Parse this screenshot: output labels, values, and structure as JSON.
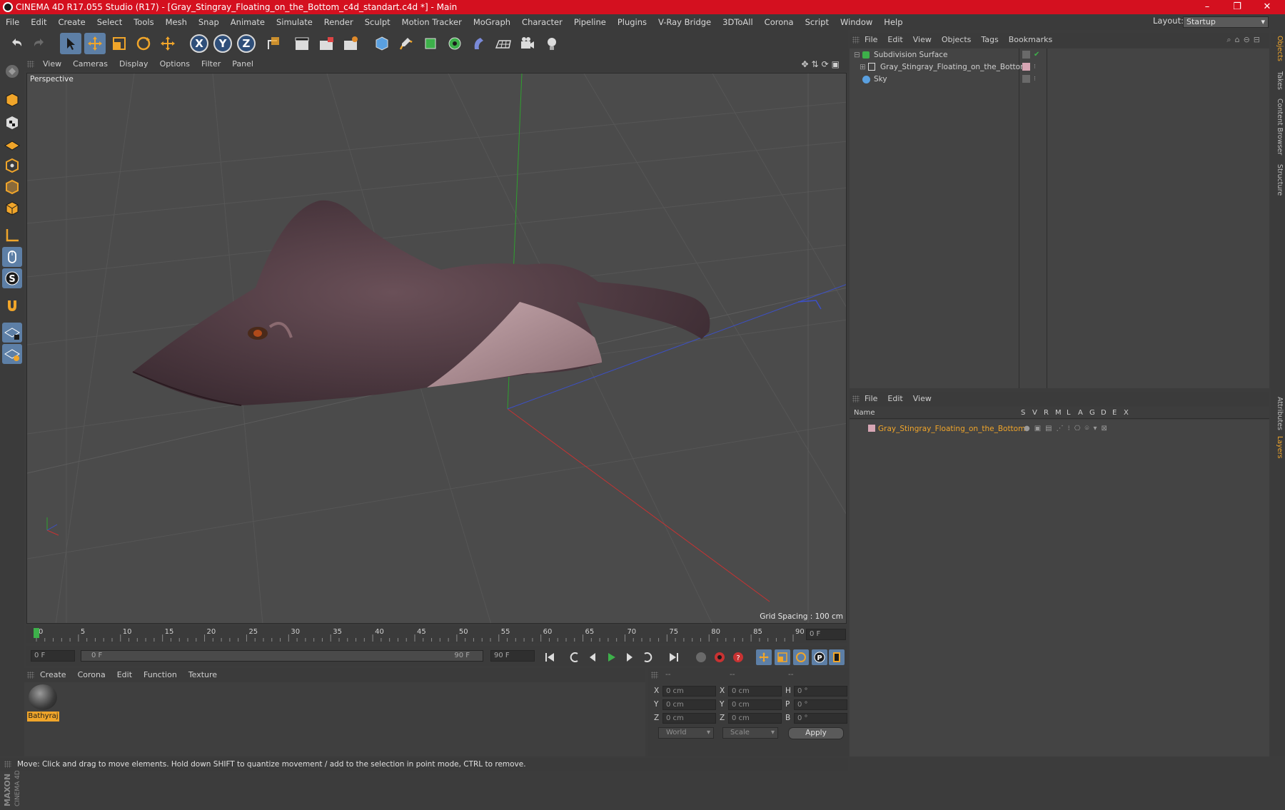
{
  "window": {
    "title": "CINEMA 4D R17.055 Studio (R17) - [Gray_Stingray_Floating_on_the_Bottom_c4d_standart.c4d *] - Main",
    "minimize": "–",
    "restore": "❐",
    "close": "✕"
  },
  "menu": [
    "File",
    "Edit",
    "Create",
    "Select",
    "Tools",
    "Mesh",
    "Snap",
    "Animate",
    "Simulate",
    "Render",
    "Sculpt",
    "Motion Tracker",
    "MoGraph",
    "Character",
    "Pipeline",
    "Plugins",
    "V-Ray Bridge",
    "3DToAll",
    "Corona",
    "Script",
    "Window",
    "Help"
  ],
  "layout": {
    "label": "Layout:",
    "value": "Startup"
  },
  "toolbar": {
    "axis_x": "X",
    "axis_y": "Y",
    "axis_z": "Z"
  },
  "viewport": {
    "menu": [
      "View",
      "Cameras",
      "Display",
      "Options",
      "Filter",
      "Panel"
    ],
    "label": "Perspective",
    "grid_spacing": "Grid Spacing : 100 cm"
  },
  "timeline": {
    "ticks": [
      "0",
      "5",
      "10",
      "15",
      "20",
      "25",
      "30",
      "35",
      "40",
      "45",
      "50",
      "55",
      "60",
      "65",
      "70",
      "75",
      "80",
      "85",
      "90"
    ],
    "current_frame": "0 F",
    "start_field": "0 F",
    "range_start": "0 F",
    "range_end": "90 F",
    "end_field": "90 F"
  },
  "material_manager": {
    "menu": [
      "Create",
      "Corona",
      "Edit",
      "Function",
      "Texture"
    ],
    "materials": [
      {
        "name": "Bathyraj"
      }
    ]
  },
  "coordinates": {
    "headers": [
      "--",
      "--",
      "--"
    ],
    "rows": [
      {
        "a": "X",
        "av": "0 cm",
        "b": "X",
        "bv": "0 cm",
        "c": "H",
        "cv": "0 °"
      },
      {
        "a": "Y",
        "av": "0 cm",
        "b": "Y",
        "bv": "0 cm",
        "c": "P",
        "cv": "0 °"
      },
      {
        "a": "Z",
        "av": "0 cm",
        "b": "Z",
        "bv": "0 cm",
        "c": "B",
        "cv": "0 °"
      }
    ],
    "space": "World",
    "mode": "Scale",
    "apply": "Apply"
  },
  "status": "Move: Click and drag to move elements. Hold down SHIFT to quantize movement / add to the selection in point mode, CTRL to remove.",
  "object_manager": {
    "menu": [
      "File",
      "Edit",
      "View",
      "Objects",
      "Tags",
      "Bookmarks"
    ],
    "objects": [
      {
        "name": "Subdivision Surface"
      },
      {
        "name": "Gray_Stingray_Floating_on_the_Bottom"
      },
      {
        "name": "Sky"
      }
    ]
  },
  "layer_manager": {
    "menu": [
      "File",
      "Edit",
      "View"
    ],
    "columns": [
      "Name",
      "S",
      "V",
      "R",
      "M",
      "L",
      "A",
      "G",
      "D",
      "E",
      "X"
    ],
    "layers": [
      {
        "name": "Gray_Stingray_Floating_on_the_Bottom",
        "color": "#d7a6b4"
      }
    ]
  },
  "right_tabs": [
    "Objects",
    "Takes",
    "Content Browser",
    "Structure",
    "Attributes",
    "Layers"
  ],
  "colors": {
    "title_bar": "#d4101f",
    "accent_blue": "#5d7fa6",
    "layer_name": "#f0a52a",
    "x_axis": "#c83232",
    "y_axis": "#2fa02f",
    "z_axis": "#3c50c8"
  }
}
